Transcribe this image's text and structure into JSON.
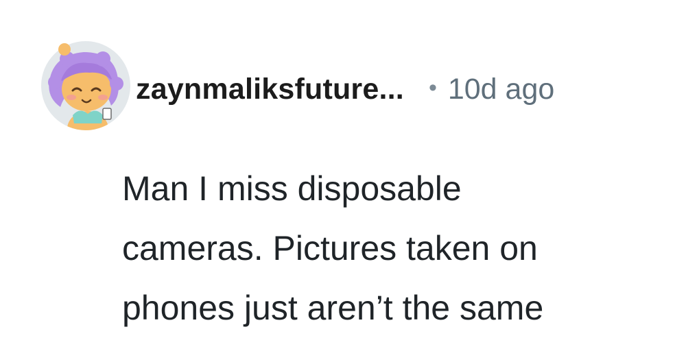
{
  "comment": {
    "avatar_icon": "user-avatar-icon",
    "username": "zaynmaliksfuture...",
    "separator": "•",
    "timestamp": "10d ago",
    "body_lines": [
      "Man I miss disposable",
      "cameras. Pictures taken on",
      "phones just aren’t the same"
    ]
  },
  "colors": {
    "username": "#1c1c1c",
    "timestamp": "#5f6f7b",
    "body": "#1f2428",
    "avatar_bg": "#e2e7ea",
    "avatar_hair": "#b38fe6",
    "avatar_skin": "#f6bd6b"
  }
}
